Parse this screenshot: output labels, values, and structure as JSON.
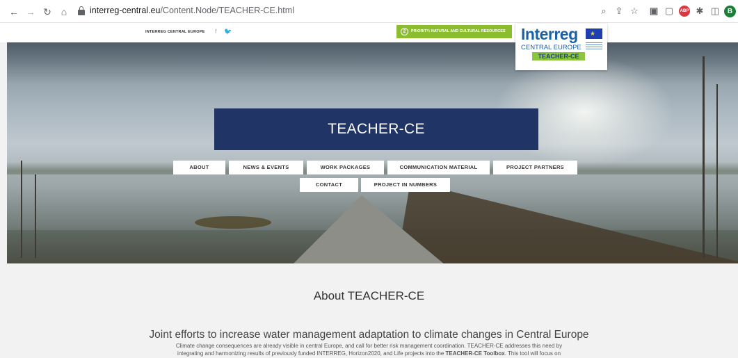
{
  "browser": {
    "url_domain": "interreg-central.eu",
    "url_path": "/Content.Node/TEACHER-CE.html",
    "profile_initial": "B",
    "abp_label": "ABP"
  },
  "site": {
    "brand_small": "INTERREG CENTRAL EUROPE",
    "priority_number": "2",
    "priority_text": "PRIORITY: NATURAL AND CULTURAL RESOURCES",
    "logo_name": "Interreg",
    "logo_sub": "CENTRAL EUROPE",
    "logo_tag": "TEACHER-CE"
  },
  "hero": {
    "title": "TEACHER-CE",
    "menu_row1": [
      "ABOUT",
      "NEWS & EVENTS",
      "WORK PACKAGES",
      "COMMUNICATION MATERIAL",
      "PROJECT PARTNERS"
    ],
    "menu_row2": [
      "CONTACT",
      "PROJECT IN NUMBERS"
    ]
  },
  "content": {
    "heading": "About TEACHER-CE",
    "subheading": "Joint efforts to increase water management adaptation to climate changes in Central Europe",
    "para_line1": "Climate change consequences are already visible in central Europe, and call for better risk management coordination. TEACHER-CE addresses this need by",
    "para_line2_pre": "integrating and harmonizing results of previously funded INTERREG, Horizon2020, and Life projects into the ",
    "para_line2_bold": "TEACHER-CE Toolbox",
    "para_line2_post": ". This tool will focus on"
  },
  "colors": {
    "title_bg": "#203466",
    "priority_green": "#8cbd2f",
    "logo_blue": "#1b61a6"
  }
}
